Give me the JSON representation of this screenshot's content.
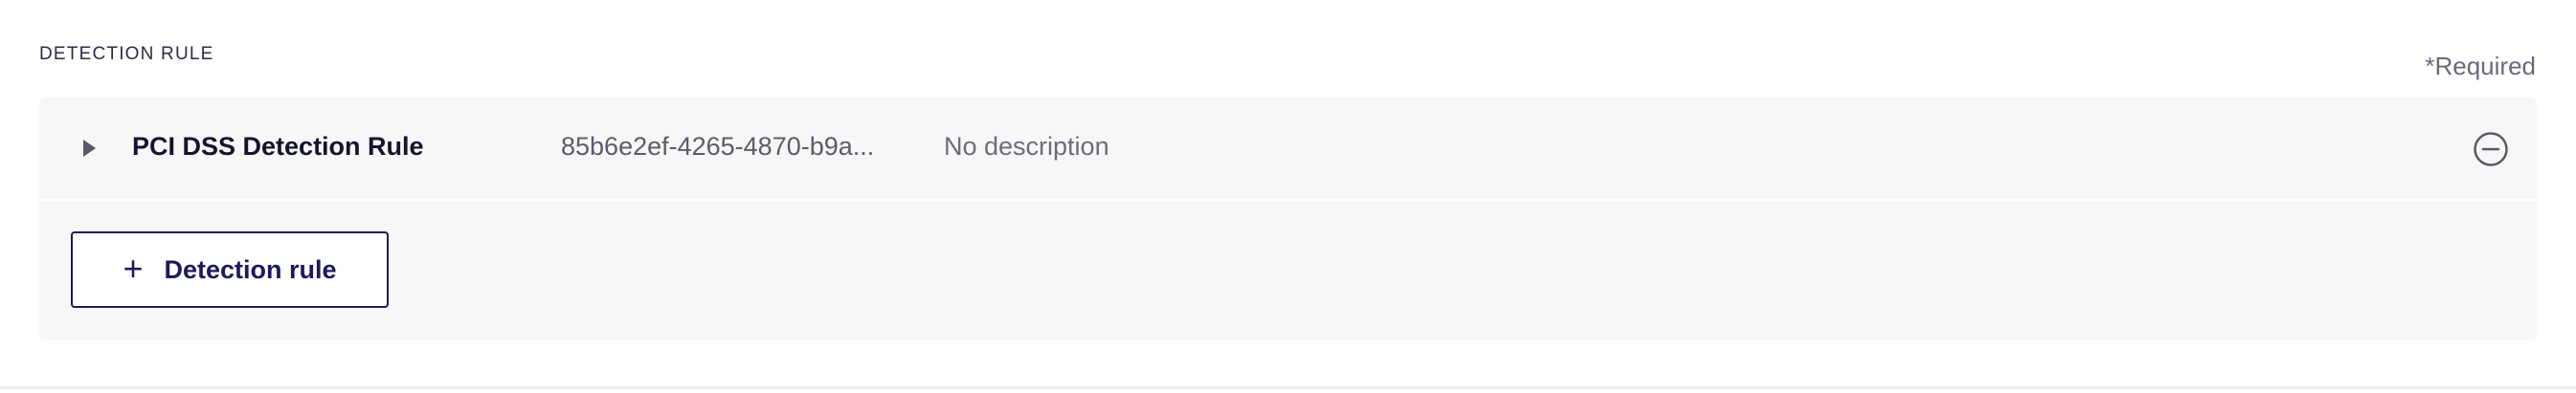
{
  "section": {
    "label": "DETECTION RULE",
    "required_note": "*Required"
  },
  "rules": [
    {
      "name": "PCI DSS Detection Rule",
      "id": "85b6e2ef-4265-4870-b9a...",
      "description": "No description"
    }
  ],
  "add_button": {
    "plus_glyph": "+",
    "label": "Detection rule"
  },
  "icons": {
    "expand": "chevron-right-icon",
    "remove": "minus-circle-icon",
    "add": "plus-icon"
  },
  "colors": {
    "accent": "#1d1a5c",
    "panel_bg": "#f7f7f7",
    "text_primary": "#14142e",
    "text_secondary": "#6c6c7a"
  }
}
